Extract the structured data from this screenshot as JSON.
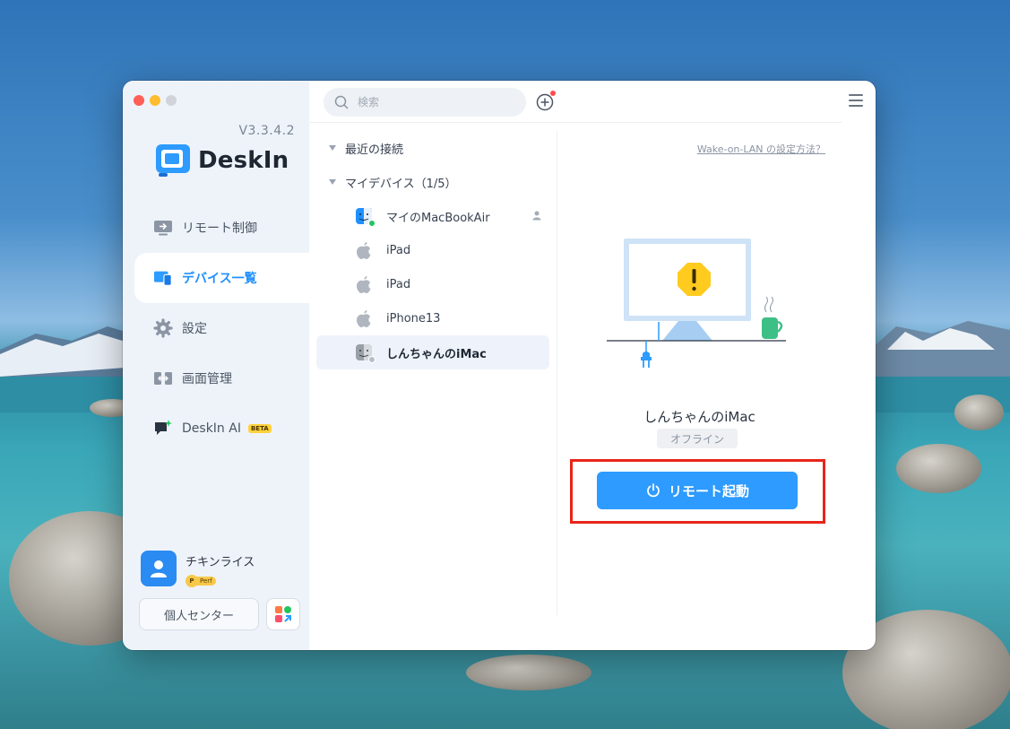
{
  "sidebar": {
    "version": "V3.3.4.2",
    "logo_text": "DeskIn",
    "nav": [
      {
        "label": "リモート制御",
        "icon": "remote-control-icon"
      },
      {
        "label": "デバイス一覧",
        "icon": "device-list-icon",
        "active": true
      },
      {
        "label": "設定",
        "icon": "gear-icon"
      },
      {
        "label": "画面管理",
        "icon": "screen-manage-icon"
      },
      {
        "label": "DeskIn AI",
        "icon": "ai-chat-icon",
        "badge": "BETA"
      }
    ],
    "user": {
      "name": "チキンライス",
      "tier_letter": "P",
      "tier_label": "Perf"
    },
    "center_button": "個人センター"
  },
  "topbar": {
    "search_placeholder": "検索"
  },
  "device_list": {
    "groups": [
      {
        "label": "最近の接続"
      },
      {
        "label": "マイデバイス（1/5）"
      }
    ],
    "devices": [
      {
        "name": "マイのMacBookAir",
        "icon": "finder-icon",
        "status": "online"
      },
      {
        "name": "iPad",
        "icon": "apple-icon",
        "status": "none"
      },
      {
        "name": "iPad",
        "icon": "apple-icon",
        "status": "none"
      },
      {
        "name": "iPhone13",
        "icon": "apple-icon",
        "status": "none"
      },
      {
        "name": "しんちゃんのiMac",
        "icon": "finder-icon",
        "status": "offline",
        "selected": true
      }
    ]
  },
  "detail": {
    "wol_link": "Wake-on-LAN の設定方法？",
    "device_name": "しんちゃんのiMac",
    "status": "オフライン",
    "remote_button": "リモート起動"
  },
  "colors": {
    "accent": "#2d9bff",
    "highlight": "#e8251a",
    "online": "#22c55e",
    "offline": "#b8bec8"
  }
}
